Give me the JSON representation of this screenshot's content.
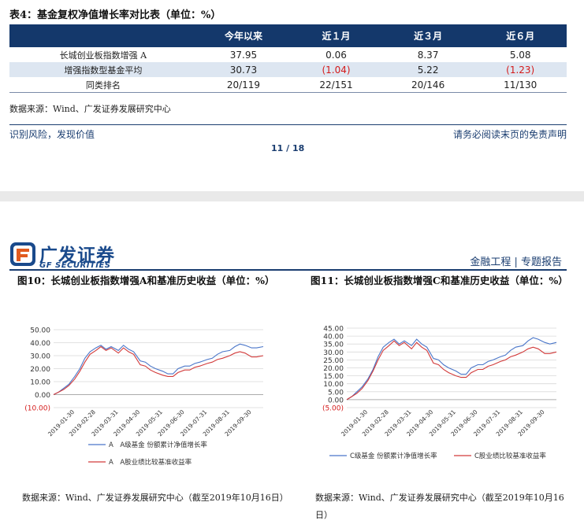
{
  "table": {
    "title": "表4：基金复权净值增长率对比表（单位：%）",
    "headers": [
      "",
      "今年以来",
      "近１月",
      "近３月",
      "近６月"
    ],
    "rows": [
      {
        "label": "长城创业板指数增强 A",
        "cells": [
          "37.95",
          "0.06",
          "8.37",
          "5.08"
        ],
        "negative": [
          false,
          false,
          false,
          false
        ]
      },
      {
        "label": "增强指数型基金平均",
        "cells": [
          "30.73",
          "(1.04)",
          "5.22",
          "(1.23)"
        ],
        "negative": [
          false,
          true,
          false,
          true
        ]
      },
      {
        "label": "同类排名",
        "cells": [
          "20/119",
          "22/151",
          "20/146",
          "11/130"
        ],
        "negative": [
          false,
          false,
          false,
          false
        ]
      }
    ],
    "source": "数据来源：Wind、广发证券发展研究中心"
  },
  "footer": {
    "left": "识别风险，发现价值",
    "right": "请务必阅读末页的免责声明",
    "page": "11 / 18"
  },
  "header2": {
    "logo_cn": "广发证券",
    "logo_en": "GF SECURITIES",
    "right": "金融工程 | 专题报告"
  },
  "colors": {
    "navy": "#14386b",
    "blue_series": "#4a76c9",
    "red_series": "#d23a3a",
    "negative": "#d41a1a"
  },
  "figure10": {
    "title": "图10：长城创业板指数增强A和基准历史收益（单位：%）",
    "source": "数据来源：Wind、广发证券发展研究中心（截至2019年10月16日）"
  },
  "figure11": {
    "title": "图11：长城创业板指数增强C和基准历史收益（单位：%）",
    "source": "数据来源：Wind、广发证券发展研究中心（截至2019年10月16日）"
  },
  "chart_data": [
    {
      "type": "line",
      "ylim": [
        -10,
        50
      ],
      "y_ticks": [
        "(10.00)",
        "0.00",
        "10.00",
        "20.00",
        "30.00",
        "40.00",
        "50.00"
      ],
      "y_tick_values": [
        -10,
        0,
        10,
        20,
        30,
        40,
        50
      ],
      "negative_tick_color": "#d41a1a",
      "x_ticks": [
        "2019-01-30",
        "2019-02-28",
        "2019-03-31",
        "2019-04-30",
        "2019-05-31",
        "2019-06-30",
        "2019-07-31",
        "2019-08-31",
        "2019-09-30"
      ],
      "x": [
        "2019-01-01",
        "2019-01-08",
        "2019-01-15",
        "2019-01-22",
        "2019-01-30",
        "2019-02-06",
        "2019-02-13",
        "2019-02-20",
        "2019-02-28",
        "2019-03-07",
        "2019-03-14",
        "2019-03-21",
        "2019-03-31",
        "2019-04-07",
        "2019-04-14",
        "2019-04-21",
        "2019-04-30",
        "2019-05-07",
        "2019-05-14",
        "2019-05-21",
        "2019-05-31",
        "2019-06-07",
        "2019-06-14",
        "2019-06-21",
        "2019-06-30",
        "2019-07-07",
        "2019-07-14",
        "2019-07-21",
        "2019-07-31",
        "2019-08-07",
        "2019-08-14",
        "2019-08-21",
        "2019-08-31",
        "2019-09-07",
        "2019-09-14",
        "2019-09-21",
        "2019-09-30",
        "2019-10-07",
        "2019-10-16"
      ],
      "series": [
        {
          "name": "A　A级基金 份额累计净值增长率",
          "color": "#4a76c9",
          "values": [
            0,
            2,
            5,
            8,
            14,
            20,
            28,
            33,
            36,
            38,
            35,
            37,
            34,
            38,
            35,
            33,
            26,
            25,
            22,
            20,
            18,
            16,
            16,
            20,
            22,
            22,
            24,
            25,
            27,
            28,
            31,
            33,
            34,
            37,
            39,
            38,
            36,
            36,
            37
          ]
        },
        {
          "name": "A　A股业绩比较基准收益率",
          "color": "#d23a3a",
          "values": [
            0,
            2,
            4,
            7,
            12,
            18,
            25,
            31,
            34,
            37,
            34,
            36,
            32,
            36,
            33,
            31,
            23,
            22,
            19,
            17,
            15,
            14,
            14,
            17,
            19,
            19,
            21,
            22,
            24,
            25,
            27,
            28,
            30,
            32,
            33,
            32,
            29,
            29,
            30
          ]
        }
      ]
    },
    {
      "type": "line",
      "ylim": [
        -5,
        45
      ],
      "y_ticks": [
        "(5.00)",
        "0.00",
        "5.00",
        "10.00",
        "15.00",
        "20.00",
        "25.00",
        "30.00",
        "35.00",
        "40.00",
        "45.00"
      ],
      "y_tick_values": [
        -5,
        0,
        5,
        10,
        15,
        20,
        25,
        30,
        35,
        40,
        45
      ],
      "negative_tick_color": "#d41a1a",
      "x_ticks": [
        "2019-01-30",
        "2019-02-28",
        "2019-03-31",
        "2019-04-30",
        "2019-05-31",
        "2019-06-30",
        "2019-07-31",
        "2019-08-31",
        "2019-09-30"
      ],
      "x": [
        "2019-01-01",
        "2019-01-08",
        "2019-01-15",
        "2019-01-22",
        "2019-01-30",
        "2019-02-06",
        "2019-02-13",
        "2019-02-20",
        "2019-02-28",
        "2019-03-07",
        "2019-03-14",
        "2019-03-21",
        "2019-03-31",
        "2019-04-07",
        "2019-04-14",
        "2019-04-21",
        "2019-04-30",
        "2019-05-07",
        "2019-05-14",
        "2019-05-21",
        "2019-05-31",
        "2019-06-07",
        "2019-06-14",
        "2019-06-21",
        "2019-06-30",
        "2019-07-07",
        "2019-07-14",
        "2019-07-21",
        "2019-07-31",
        "2019-08-07",
        "2019-08-14",
        "2019-08-21",
        "2019-08-31",
        "2019-09-07",
        "2019-09-14",
        "2019-09-21",
        "2019-09-30",
        "2019-10-07",
        "2019-10-16"
      ],
      "series": [
        {
          "name": "C级基金 份额累计净值增长率",
          "color": "#4a76c9",
          "values": [
            0,
            2,
            5,
            8,
            13,
            19,
            27,
            33,
            36,
            38,
            35,
            37,
            34,
            38,
            35,
            33,
            26,
            25,
            22,
            20,
            18,
            16,
            16,
            20,
            22,
            22,
            24,
            25,
            27,
            28,
            31,
            33,
            34,
            37,
            39,
            38,
            36,
            35,
            36
          ]
        },
        {
          "name": "C股业绩比较基准收益率",
          "color": "#d23a3a",
          "values": [
            0,
            2,
            4,
            7,
            12,
            18,
            25,
            31,
            34,
            37,
            34,
            36,
            32,
            36,
            33,
            31,
            23,
            22,
            19,
            17,
            15,
            14,
            14,
            17,
            19,
            19,
            21,
            22,
            24,
            25,
            27,
            28,
            30,
            32,
            33,
            32,
            29,
            29,
            30
          ]
        }
      ]
    }
  ]
}
